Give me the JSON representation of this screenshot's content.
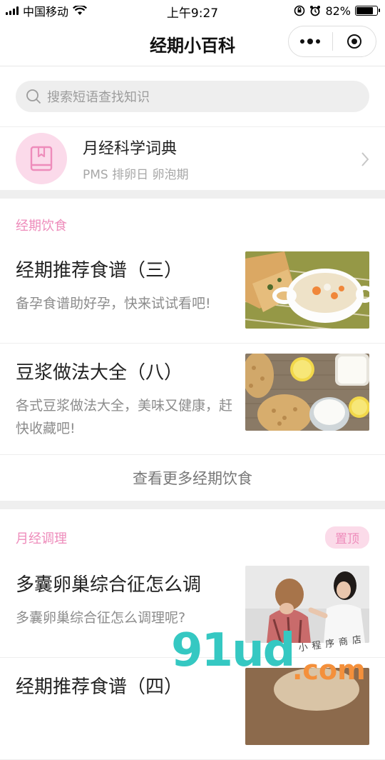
{
  "status_bar": {
    "carrier": "中国移动",
    "time": "上午9:27",
    "battery": "82%",
    "battery_level": 0.82
  },
  "navbar": {
    "title": "经期小百科"
  },
  "search": {
    "placeholder": "搜索短语查找知识"
  },
  "dictionary": {
    "title": "月经科学词典",
    "subtitle": "PMS 排卵日 卵泡期",
    "icon": "book-icon"
  },
  "sections": [
    {
      "label": "经期饮食",
      "articles": [
        {
          "title": "经期推荐食谱（三）",
          "desc": "备孕食谱助好孕，快来试试看吧!",
          "thumb": "soup-image"
        },
        {
          "title": "豆浆做法大全（八）",
          "desc": "各式豆浆做法大全，美味又健康，赶快收藏吧!",
          "thumb": "soybeans-image"
        }
      ],
      "more": "查看更多经期饮食"
    },
    {
      "label": "月经调理",
      "badge": "置顶",
      "articles": [
        {
          "title": "多囊卵巢综合征怎么调",
          "desc": "多囊卵巢综合征怎么调理呢?",
          "thumb": "women-image"
        },
        {
          "title": "经期推荐食谱（四）",
          "desc": "",
          "thumb": "food-image"
        }
      ]
    }
  ],
  "watermark": {
    "brand": "91ud",
    "suffix": ".com",
    "tagline": "小程序商店"
  },
  "colors": {
    "accent_pink": "#ee8cbb",
    "pink_light": "#fbdaea"
  }
}
